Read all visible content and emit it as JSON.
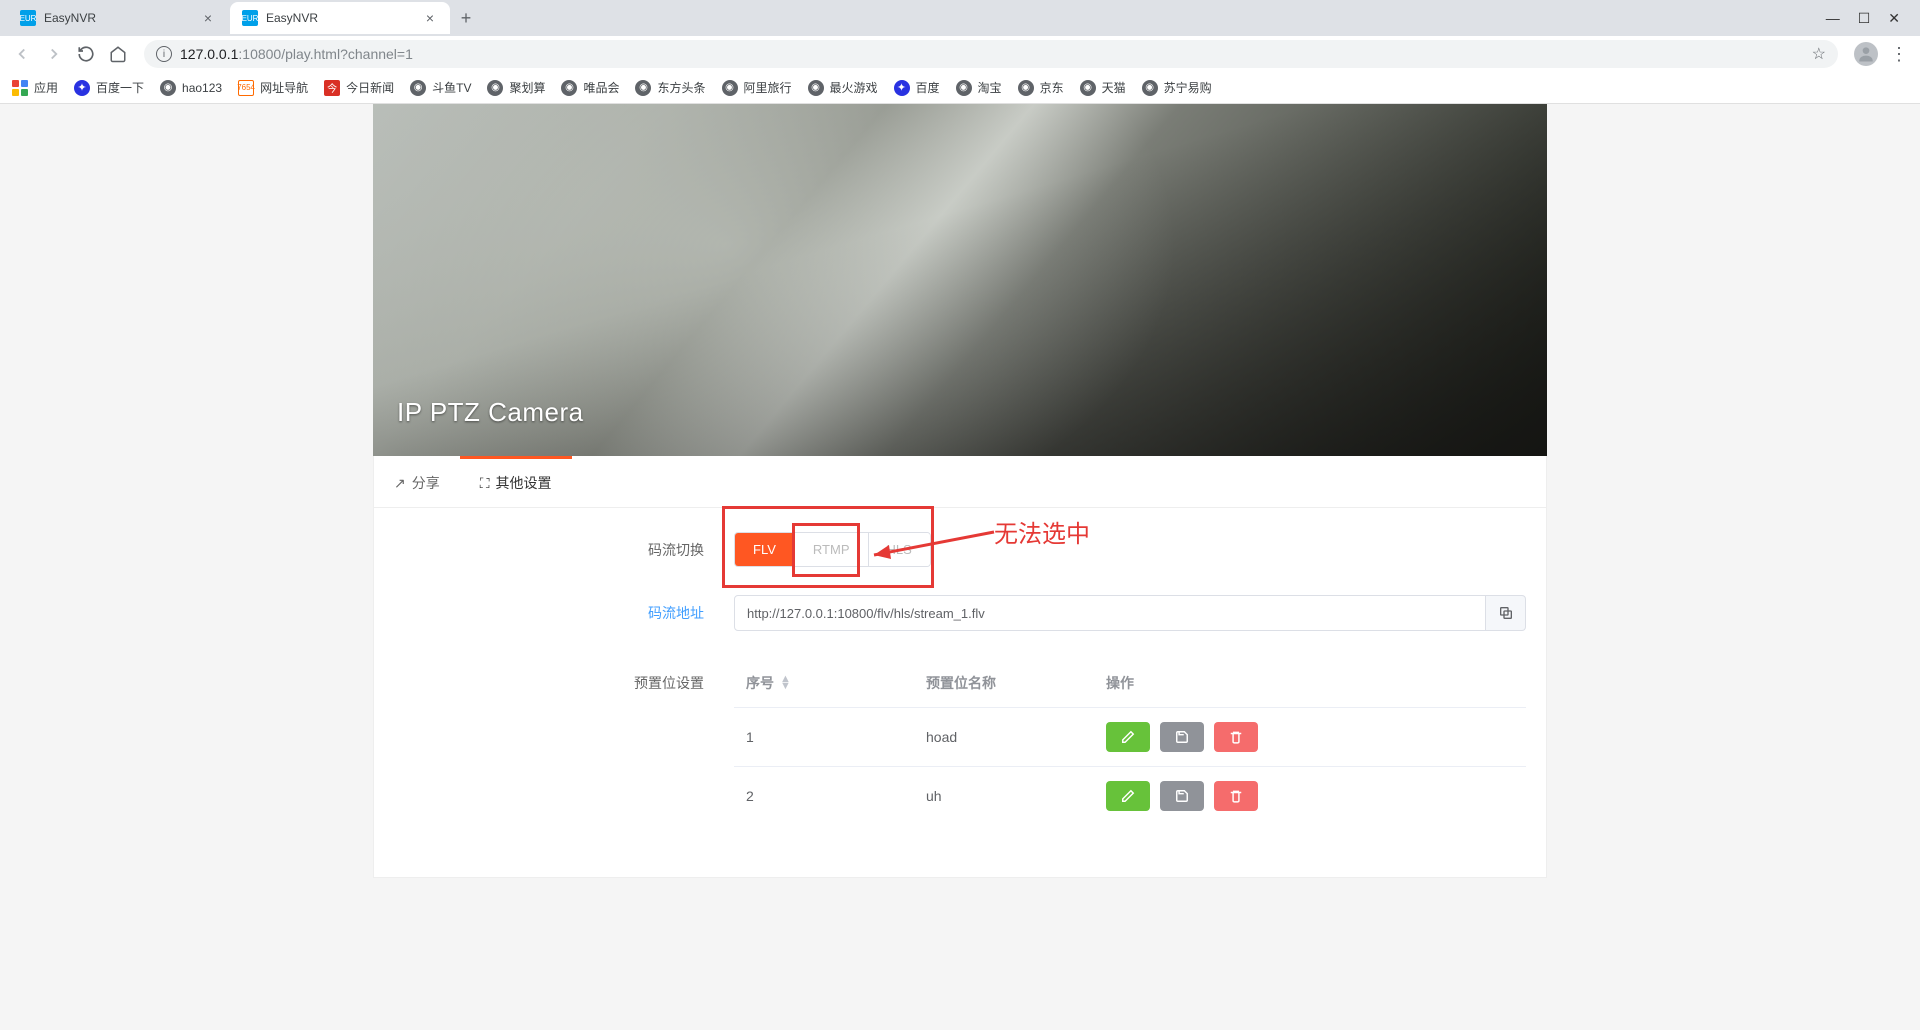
{
  "browser": {
    "tabs": [
      {
        "title": "EasyNVR",
        "active": false
      },
      {
        "title": "EasyNVR",
        "active": true
      }
    ],
    "url_prefix": "127.0.0.1",
    "url_suffix": ":10800/play.html?channel=1",
    "apps_label": "应用",
    "bookmarks": [
      {
        "label": "百度一下"
      },
      {
        "label": "hao123"
      },
      {
        "label": "网址导航"
      },
      {
        "label": "今日新闻"
      },
      {
        "label": "斗鱼TV"
      },
      {
        "label": "聚划算"
      },
      {
        "label": "唯品会"
      },
      {
        "label": "东方头条"
      },
      {
        "label": "阿里旅行"
      },
      {
        "label": "最火游戏"
      },
      {
        "label": "百度"
      },
      {
        "label": "淘宝"
      },
      {
        "label": "京东"
      },
      {
        "label": "天猫"
      },
      {
        "label": "苏宁易购"
      }
    ]
  },
  "video": {
    "overlay_title": "IP PTZ Camera"
  },
  "panel": {
    "tab_share": "分享",
    "tab_settings": "其他设置"
  },
  "form": {
    "stream_switch_label": "码流切换",
    "stream_options": {
      "flv": "FLV",
      "rtmp": "RTMP",
      "hls": "HLS"
    },
    "stream_url_label": "码流地址",
    "stream_url_value": "http://127.0.0.1:10800/flv/hls/stream_1.flv",
    "preset_label": "预置位设置"
  },
  "table": {
    "col_index": "序号",
    "col_name": "预置位名称",
    "col_ops": "操作",
    "rows": [
      {
        "index": "1",
        "name": "hoad"
      },
      {
        "index": "2",
        "name": "uh"
      }
    ]
  },
  "annotation": {
    "text": "无法选中"
  }
}
